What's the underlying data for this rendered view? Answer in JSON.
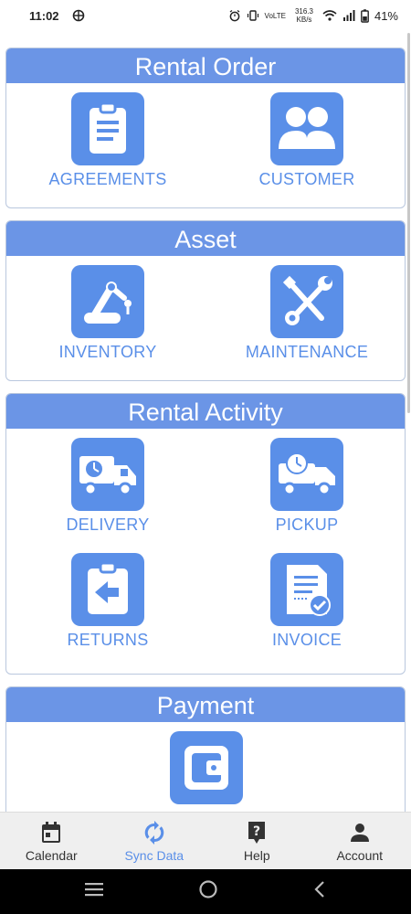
{
  "status": {
    "time": "11:02",
    "network": "VoLTE",
    "speed": "316.3 KB/s",
    "battery": "41%"
  },
  "sections": {
    "rental_order": {
      "title": "Rental Order",
      "agreements": "AGREEMENTS",
      "customer": "CUSTOMER"
    },
    "asset": {
      "title": "Asset",
      "inventory": "INVENTORY",
      "maintenance": "MAINTENANCE"
    },
    "rental_activity": {
      "title": "Rental Activity",
      "delivery": "DELIVERY",
      "pickup": "PICKUP",
      "returns": "RETURNS",
      "invoice": "INVOICE"
    },
    "payment": {
      "title": "Payment"
    }
  },
  "bottom_nav": {
    "calendar": "Calendar",
    "sync": "Sync Data",
    "help": "Help",
    "account": "Account",
    "active": "Sync Data"
  },
  "colors": {
    "accent": "#5a8fe8",
    "header": "#6b95e6",
    "nav_bg": "#efefef"
  },
  "icons": [
    "agreements-clipboard-icon",
    "customer-group-icon",
    "inventory-robot-arm-icon",
    "maintenance-tools-icon",
    "delivery-truck-clock-icon",
    "pickup-truck-icon",
    "returns-clipboard-arrow-icon",
    "invoice-document-check-icon",
    "payment-wallet-icon",
    "calendar-icon",
    "sync-icon",
    "help-icon",
    "account-icon"
  ]
}
